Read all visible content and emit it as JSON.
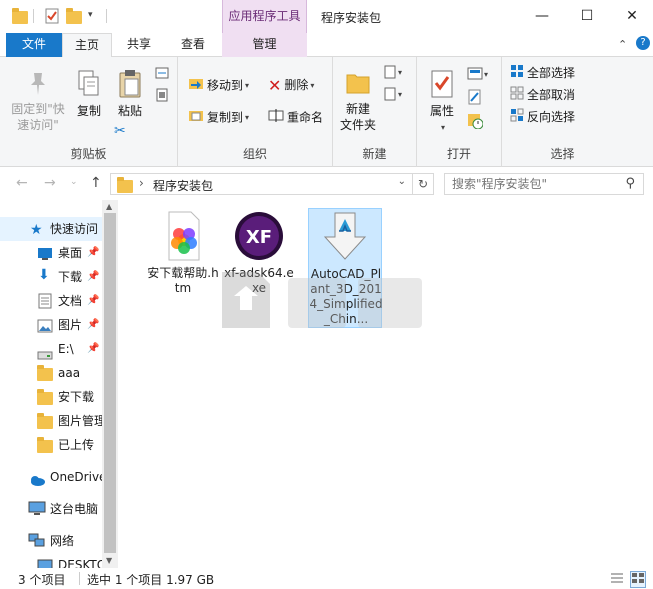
{
  "window": {
    "title": "程序安装包",
    "contextual_tab_group": "应用程序工具",
    "buttons": {
      "minimize": "—",
      "maximize": "☐",
      "close": "✕"
    }
  },
  "ribbon_tabs": {
    "file": "文件",
    "home": "主页",
    "share": "共享",
    "view": "查看",
    "manage": "管理"
  },
  "ribbon": {
    "clipboard": {
      "label": "剪贴板",
      "pin_quick_access": "固定到\"快\n速访问\"",
      "copy": "复制",
      "paste": "粘贴"
    },
    "organize": {
      "label": "组织",
      "move_to": "移动到",
      "copy_to": "复制到",
      "delete": "删除",
      "rename": "重命名"
    },
    "new": {
      "label": "新建",
      "new_folder": "新建\n文件夹"
    },
    "open": {
      "label": "打开",
      "properties": "属性"
    },
    "select": {
      "label": "选择",
      "select_all": "全部选择",
      "select_none": "全部取消",
      "invert": "反向选择"
    }
  },
  "address": {
    "path": "程序安装包",
    "separator": "›",
    "search_placeholder": "搜索\"程序安装包\""
  },
  "nav_pane": {
    "quick_access": "快速访问",
    "items": [
      {
        "label": "桌面",
        "pinned": true
      },
      {
        "label": "下载",
        "pinned": true
      },
      {
        "label": "文档",
        "pinned": true
      },
      {
        "label": "图片",
        "pinned": true
      },
      {
        "label": "E:\\",
        "pinned": true
      },
      {
        "label": "aaa",
        "pinned": false
      },
      {
        "label": "安下载",
        "pinned": false
      },
      {
        "label": "图片管理",
        "pinned": false
      },
      {
        "label": "已上传",
        "pinned": false
      }
    ],
    "onedrive": "OneDrive",
    "this_pc": "这台电脑",
    "network": "网络",
    "desktop_partial": "DESKTO"
  },
  "files": [
    {
      "name": "安下载帮助.htm",
      "icon": "htm-file-icon"
    },
    {
      "name": "xf-adsk64.exe",
      "icon": "xf-keygen-icon"
    },
    {
      "name": "AutoCAD_Plant_3D_2014_Simplified_Chin...",
      "icon": "autodesk-installer-icon",
      "selected": true
    }
  ],
  "status": {
    "count": "3 个项目",
    "selection": "选中 1 个项目  1.97 GB"
  },
  "colors": {
    "accent": "#1979ca",
    "context_tab": "#f0dff2",
    "selection_fill": "#cce8ff",
    "folder": "#f3c24d"
  }
}
